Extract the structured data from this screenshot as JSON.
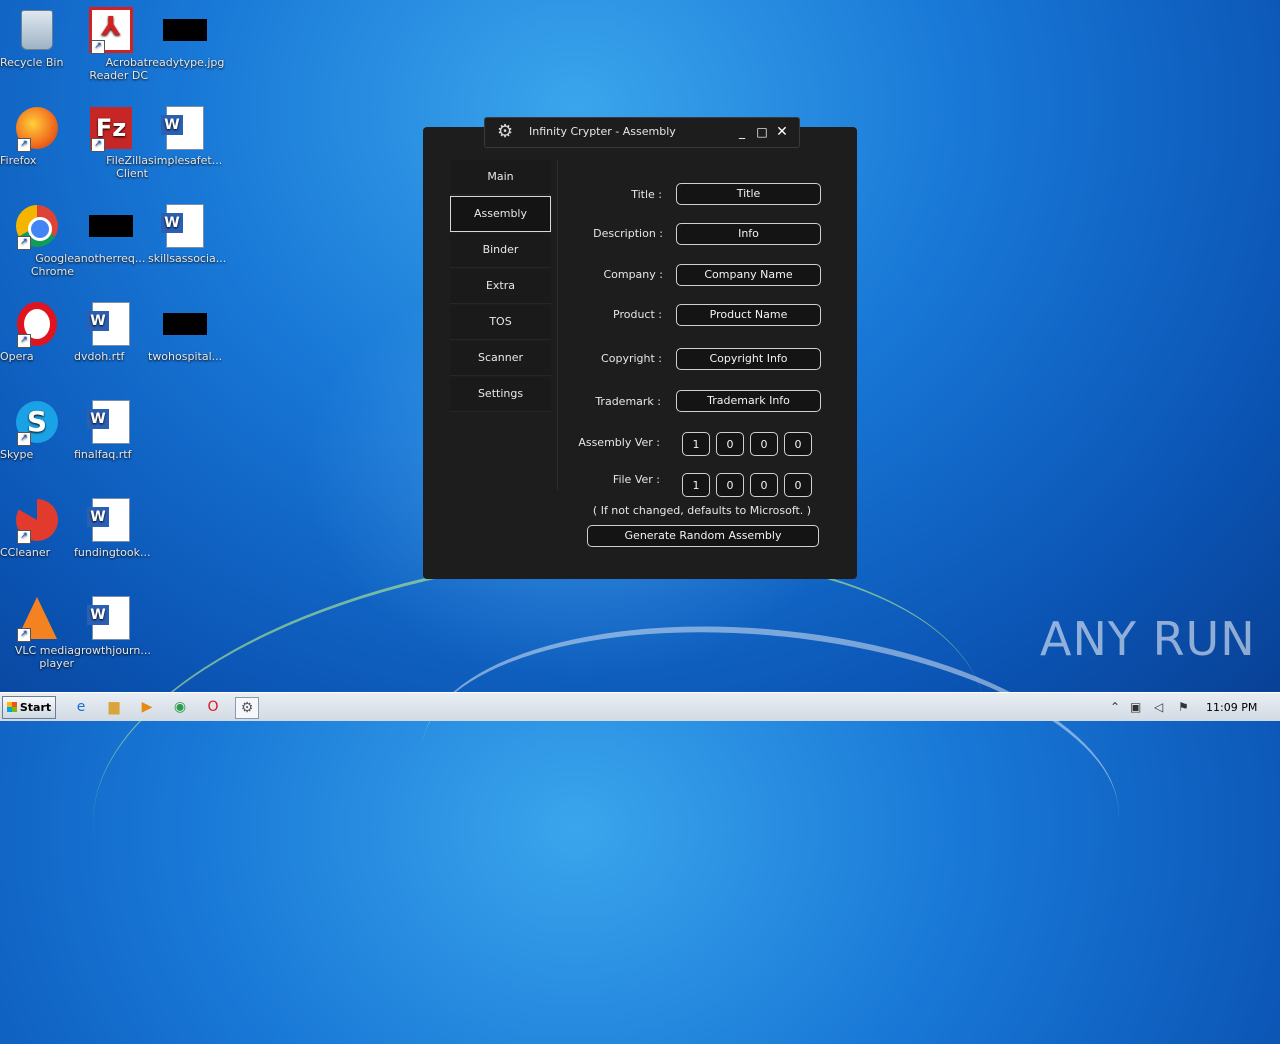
{
  "desktop": {
    "icons": [
      {
        "label": "Recycle Bin",
        "icon": "recycle-bin-icon"
      },
      {
        "label": "Acrobat Reader DC",
        "icon": "acrobat-reader-icon"
      },
      {
        "label": "readytype.jpg",
        "icon": "image-file-icon"
      },
      {
        "label": "Firefox",
        "icon": "firefox-icon"
      },
      {
        "label": "FileZilla Client",
        "icon": "filezilla-icon"
      },
      {
        "label": "simplesafet...",
        "icon": "word-document-icon"
      },
      {
        "label": "Google Chrome",
        "icon": "chrome-icon"
      },
      {
        "label": "anotherreq...",
        "icon": "image-file-icon"
      },
      {
        "label": "skillsassocia...",
        "icon": "word-document-icon"
      },
      {
        "label": "Opera",
        "icon": "opera-icon"
      },
      {
        "label": "dvdoh.rtf",
        "icon": "word-document-icon"
      },
      {
        "label": "twohospital...",
        "icon": "image-file-icon"
      },
      {
        "label": "Skype",
        "icon": "skype-icon"
      },
      {
        "label": "finalfaq.rtf",
        "icon": "word-document-icon"
      },
      {
        "label": "CCleaner",
        "icon": "ccleaner-icon"
      },
      {
        "label": "fundingtook...",
        "icon": "word-document-icon"
      },
      {
        "label": "VLC media player",
        "icon": "vlc-icon"
      },
      {
        "label": "growthjourn...",
        "icon": "word-document-icon"
      }
    ]
  },
  "window": {
    "title": "Infinity Crypter - Assembly",
    "min_glyph": "_",
    "max_glyph": "□",
    "close_glyph": "✕",
    "nav": [
      {
        "label": "Main"
      },
      {
        "label": "Assembly",
        "active": true
      },
      {
        "label": "Binder"
      },
      {
        "label": "Extra"
      },
      {
        "label": "TOS"
      },
      {
        "label": "Scanner"
      },
      {
        "label": "Settings"
      }
    ],
    "form": {
      "title_label": "Title :",
      "title_value": "Title",
      "description_label": "Description :",
      "description_value": "Info",
      "company_label": "Company :",
      "company_value": "Company Name",
      "product_label": "Product :",
      "product_value": "Product Name",
      "copyright_label": "Copyright :",
      "copyright_value": "Copyright Info",
      "trademark_label": "Trademark :",
      "trademark_value": "Trademark Info",
      "assembly_ver_label": "Assembly Ver :",
      "assembly_ver": [
        "1",
        "0",
        "0",
        "0"
      ],
      "file_ver_label": "File Ver :",
      "file_ver": [
        "1",
        "0",
        "0",
        "0"
      ],
      "note": "( If not changed, defaults to Microsoft. )",
      "generate_label": "Generate Random Assembly"
    }
  },
  "watermark": "ANY RUN",
  "taskbar": {
    "start_label": "Start",
    "clock": "11:09 PM"
  }
}
